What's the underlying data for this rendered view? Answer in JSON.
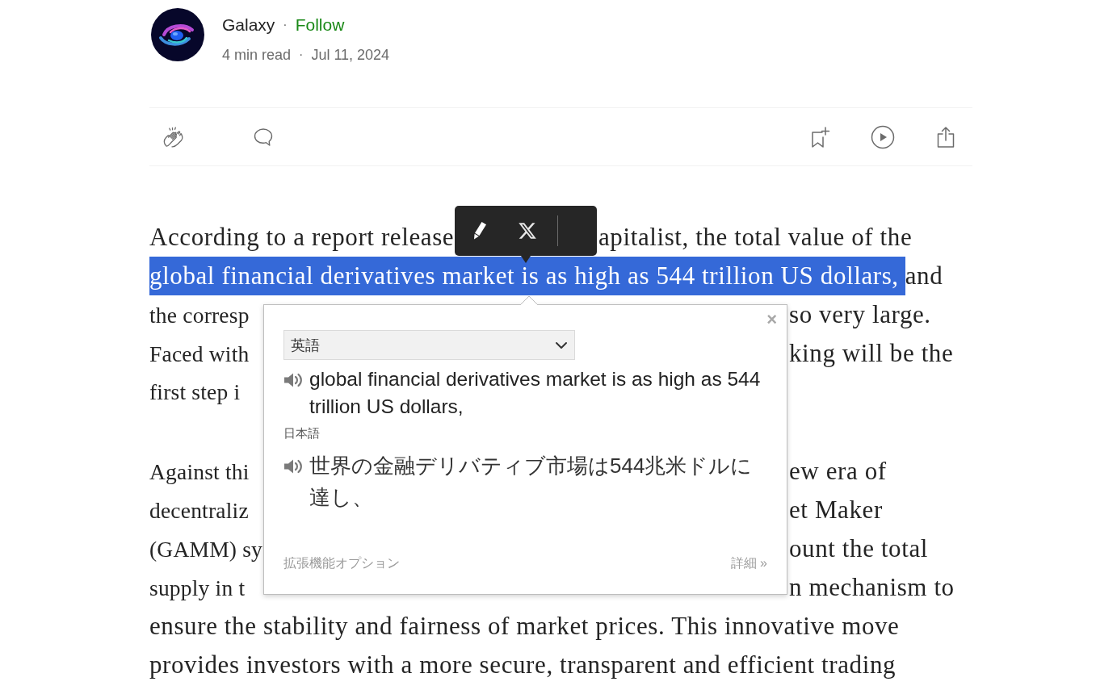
{
  "author": {
    "name": "Galaxy",
    "separator": "·",
    "follow": "Follow"
  },
  "meta": {
    "read_time": "4 min read",
    "separator": "·",
    "date": "Jul 11, 2024"
  },
  "article": {
    "paragraphs": [
      {
        "lines": [
          {
            "kind": "toolbar",
            "segments": [
              {
                "text": "According to a report release",
                "selected": false
              },
              {
                "text": "apitalist, the total value of the",
                "selected": false
              }
            ]
          },
          {
            "kind": "plain",
            "segments": [
              {
                "text": "global financial derivatives market is as high as 544 trillion US dollars,",
                "selected": true
              },
              {
                "text": "and",
                "selected": false
              }
            ]
          },
          {
            "kind": "popup",
            "segments": [
              {
                "text": "the corresp",
                "selected": false
              },
              {
                "text": "so very large.",
                "selected": false
              }
            ]
          },
          {
            "kind": "popup",
            "segments": [
              {
                "text": "Faced with",
                "selected": false
              },
              {
                "text": "king will be the",
                "selected": false
              }
            ]
          },
          {
            "kind": "popup",
            "segments": [
              {
                "text": "first step i",
                "selected": false
              }
            ]
          }
        ]
      },
      {
        "lines": [
          {
            "kind": "popup",
            "segments": [
              {
                "text": "Against thi",
                "selected": false
              },
              {
                "text": "ew era of",
                "selected": false
              }
            ]
          },
          {
            "kind": "popup",
            "segments": [
              {
                "text": "decentraliz",
                "selected": false
              },
              {
                "text": "et Maker",
                "selected": false
              }
            ]
          },
          {
            "kind": "popup",
            "segments": [
              {
                "text": "(GAMM) sy",
                "selected": false
              },
              {
                "text": "ount the total",
                "selected": false
              }
            ]
          },
          {
            "kind": "popup",
            "segments": [
              {
                "text": "supply in t",
                "selected": false
              },
              {
                "text": "n mechanism to",
                "selected": false
              }
            ]
          },
          {
            "kind": "plain",
            "segments": [
              {
                "text": "ensure the stability and fairness of market prices. This innovative move",
                "selected": false
              }
            ]
          },
          {
            "kind": "plain",
            "segments": [
              {
                "text": "provides investors with a more secure, transparent and efficient trading",
                "selected": false
              }
            ]
          }
        ]
      }
    ]
  },
  "translate_popup": {
    "close": "×",
    "source_language": "英語",
    "source_text": "global financial derivatives market is as high as 544 trillion US dollars,",
    "target_language": "日本語",
    "translation": "世界の金融デリバティブ市場は544兆米ドルに達し、",
    "options_link": "拡張機能オプション",
    "more_link": "詳細 »"
  }
}
